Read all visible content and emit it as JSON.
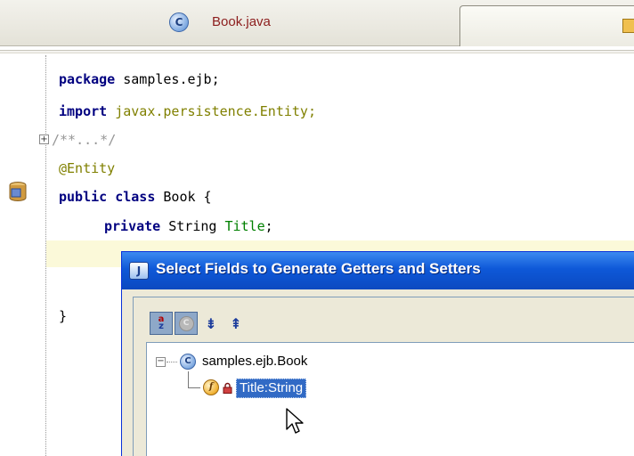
{
  "tab": {
    "file_name": "Book.java",
    "class_icon_glyph": "C"
  },
  "editor": {
    "line1_kw": "package",
    "line1_rest": " samples.ejb;",
    "line2_kw": "import",
    "line2_rest": " javax.persistence.Entity;",
    "line3_comment": "/**...*/",
    "line4_annotation": "@Entity",
    "line5_kw1": "public",
    "line5_kw2": " class",
    "line5_rest": " Book {",
    "line6_kw": "private",
    "line6_type": " String ",
    "line6_field": "Title",
    "line6_end": ";",
    "line9_brace": "}",
    "fold_glyph": "+"
  },
  "dialog": {
    "title": "Select Fields to Generate Getters and Setters",
    "title_icon_glyph": "J",
    "toolbar": {
      "sort_a": "a",
      "sort_z": "z",
      "circle_glyph": "C",
      "expand_glyph": "⇟",
      "collapse_glyph": "⇞"
    },
    "tree": {
      "expander_glyph": "−",
      "class_glyph": "C",
      "class_label": "samples.ejb.Book",
      "field_glyph": "f",
      "field_label": "Title:String"
    }
  },
  "colors": {
    "keyword": "#000080",
    "annotation": "#808000",
    "comment": "#969696",
    "field": "#008000",
    "selection": "#316ac5",
    "title_bar": "#0e58d8"
  },
  "icons": [
    "class-icon",
    "entity-bean-icon",
    "fold-icon",
    "app-icon",
    "sort-alpha-icon",
    "filter-icon",
    "expand-all-icon",
    "collapse-all-icon",
    "field-icon",
    "lock-icon",
    "mouse-cursor-icon"
  ]
}
